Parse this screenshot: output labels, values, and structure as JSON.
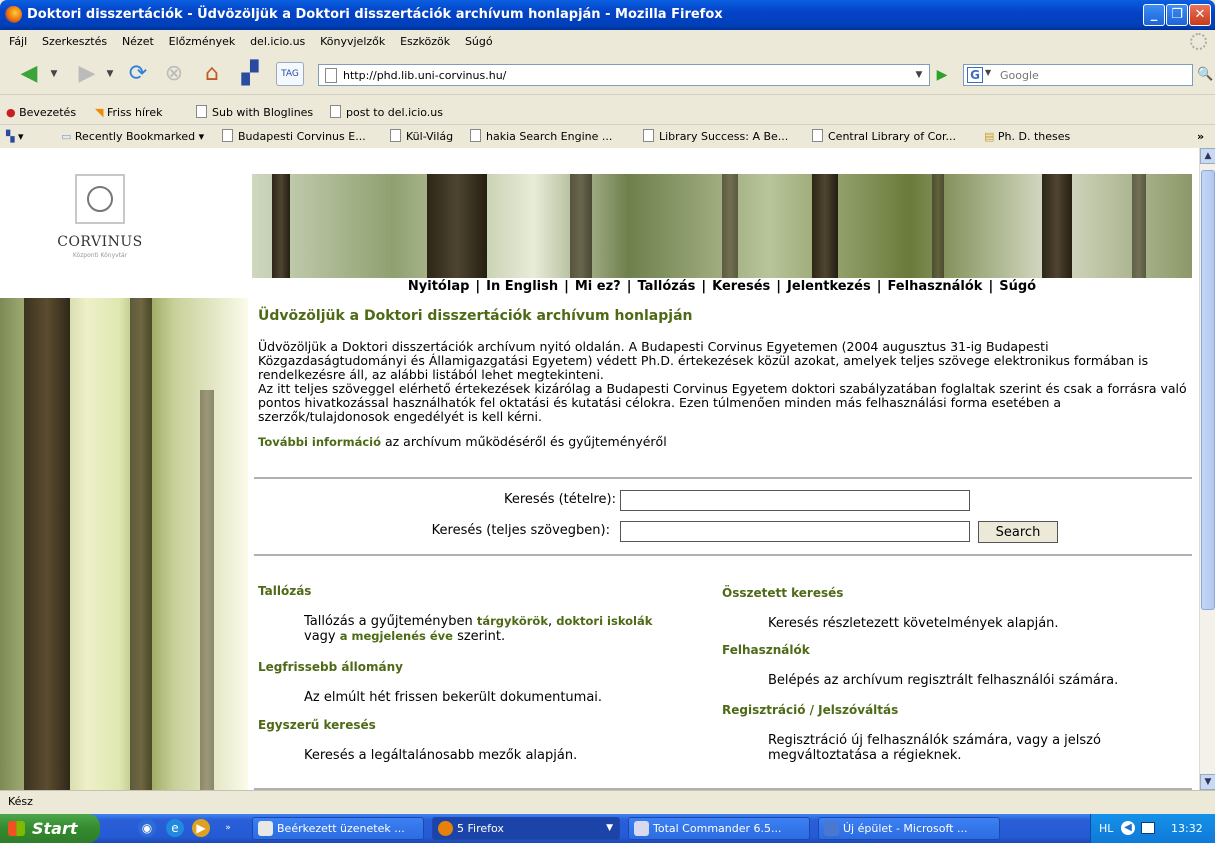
{
  "window": {
    "title": "Doktori disszertációk - Üdvözöljük a Doktori disszertációk archívum honlapján - Mozilla Firefox"
  },
  "menu": [
    "Fájl",
    "Szerkesztés",
    "Nézet",
    "Előzmények",
    "del.icio.us",
    "Könyvjelzők",
    "Eszközök",
    "Súgó"
  ],
  "nav": {
    "url": "http://phd.lib.uni-corvinus.hu/",
    "search_placeholder": "Google",
    "tag_label": "TAG"
  },
  "bookmarks1": [
    "Bevezetés",
    "Friss hírek",
    "Sub with Bloglines",
    "post to del.icio.us"
  ],
  "bookmarks2": [
    "Recently Bookmarked",
    "Budapesti Corvinus E...",
    "Kül-Világ",
    "hakia Search Engine ...",
    "Library Success: A Be...",
    "Central Library of Cor...",
    "Ph. D. theses"
  ],
  "bookmarks2_more": "»",
  "logo": {
    "name": "CORVINUS",
    "sub": "Központi Könyvtár"
  },
  "site_nav": [
    "Nyitólap",
    "In English",
    "Mi ez?",
    "Tallózás",
    "Keresés",
    "Jelentkezés",
    "Felhasználók",
    "Súgó"
  ],
  "page": {
    "title": "Üdvözöljük a Doktori disszertációk archívum honlapján",
    "intro1": "Üdvözöljük a Doktori disszertációk archívum nyitó oldalán. A Budapesti Corvinus Egyetemen (2004 augusztus 31-ig Budapesti Közgazdaságtudományi és Államigazgatási Egyetem) védett Ph.D. értekezések közül azokat, amelyek teljes szövege elektronikus formában is rendelkezésre áll, az alábbi listából lehet megtekinteni.",
    "intro2": "Az itt teljes szöveggel elérhető értekezések kizárólag a Budapesti Corvinus Egyetem doktori szabályzatában foglaltak szerint és csak a forrásra való pontos hivatkozással használhatók fel oktatási és kutatási célokra. Ezen túlmenően minden más felhasználási forma esetében a szerzők/tulajdonosok engedélyét is kell kérni.",
    "more_link": "További információ",
    "more_text": " az archívum működéséről és gyűjteményéről"
  },
  "search": {
    "item_label": "Keresés (tételre):",
    "fulltext_label": "Keresés (teljes szövegben):",
    "button": "Search"
  },
  "sections": {
    "browse_title": "Tallózás",
    "browse_text1": "Tallózás a gyűjteményben ",
    "browse_link1": "tárgykörök",
    "browse_sep": ", ",
    "browse_link2": "doktori iskolák",
    "browse_text2": "vagy ",
    "browse_link3": "a megjelenés éve",
    "browse_text3": " szerint.",
    "latest_title": "Legfrissebb állomány",
    "latest_text": "Az elmúlt hét frissen bekerült dokumentumai.",
    "simple_title": "Egyszerű keresés",
    "simple_text": "Keresés a legáltalánosabb mezők alapján.",
    "complex_title": "Összetett keresés",
    "complex_text": "Keresés részletezett követelmények alapján.",
    "users_title": "Felhasználók",
    "users_text": "Belépés az archívum regisztrált felhasználói számára.",
    "reg_title": "Regisztráció / Jelszóváltás",
    "reg_text1": "Regisztráció új felhasználók számára, vagy a jelszó",
    "reg_text2": "megváltoztatása a régieknek."
  },
  "status": "Kész",
  "taskbar": {
    "start": "Start",
    "tasks": [
      "Beérkezett üzenetek ...",
      "5 Firefox",
      "Total Commander 6.5...",
      "Új épület - Microsoft ..."
    ],
    "lang": "HL",
    "clock": "13:32"
  }
}
